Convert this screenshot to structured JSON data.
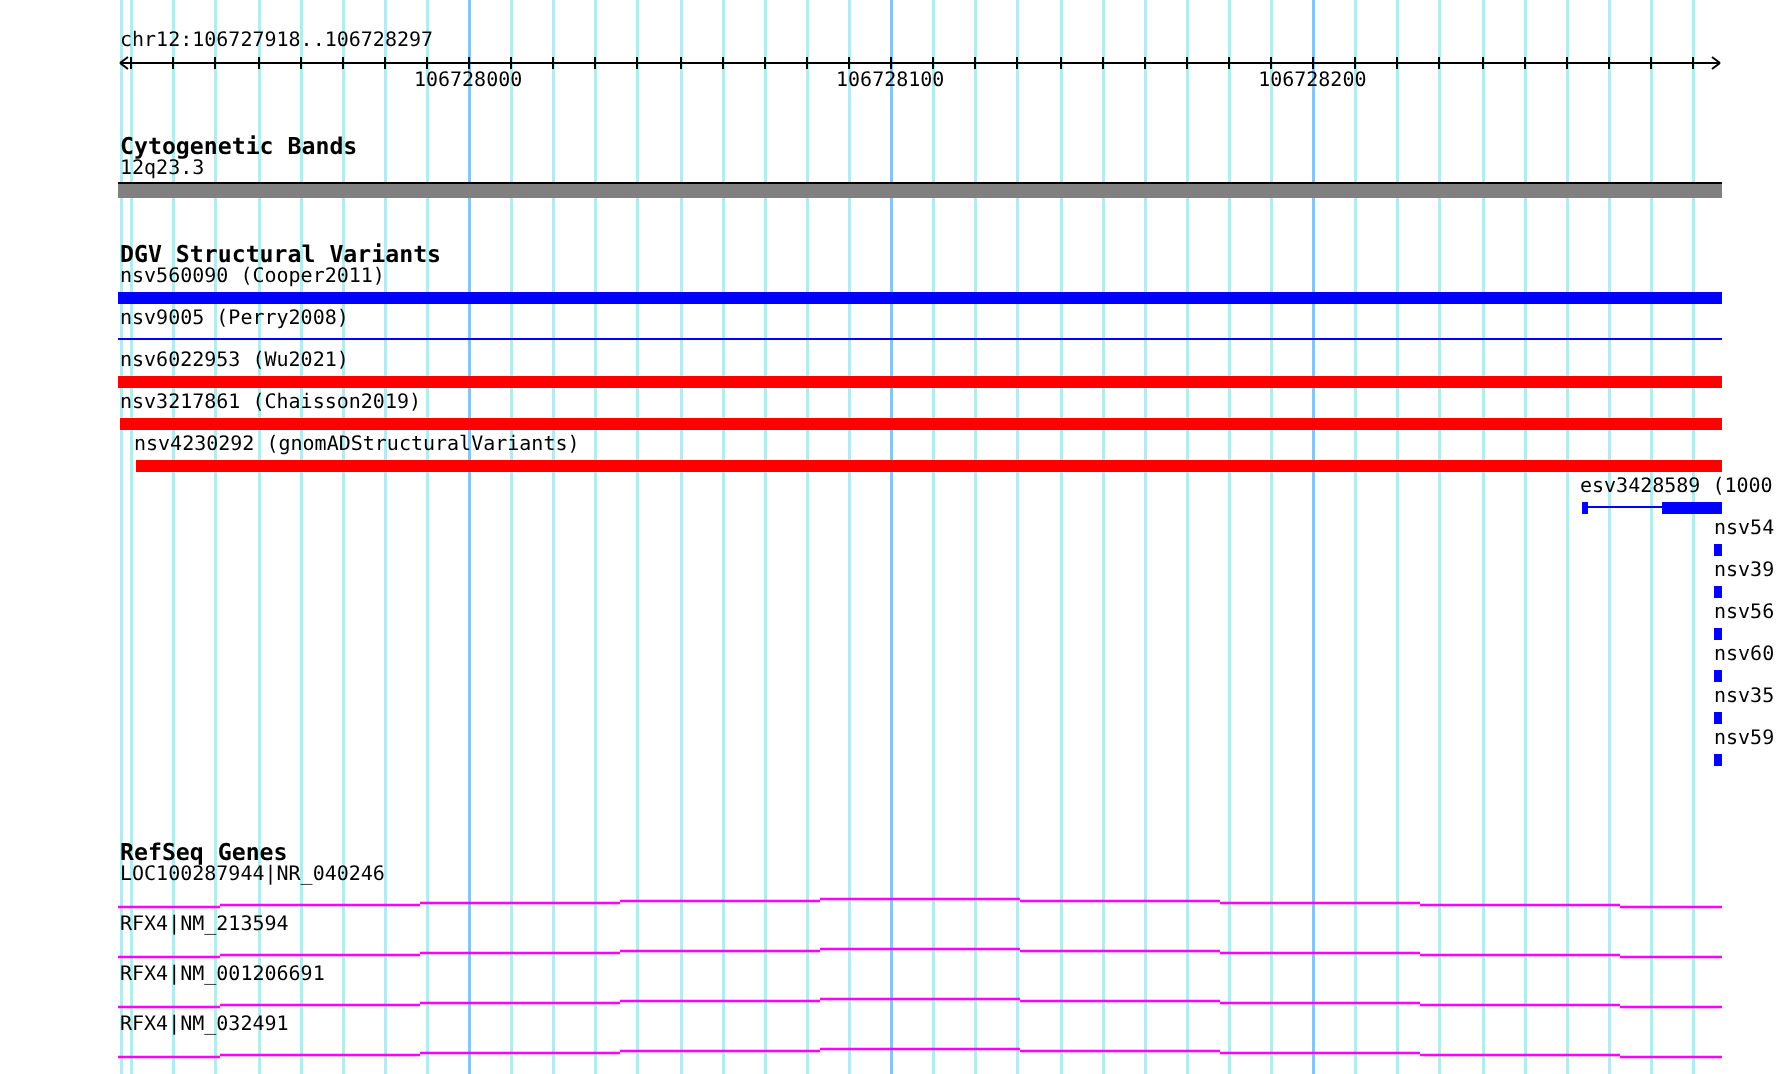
{
  "ruler": {
    "region": "chr12:106727918..106728297",
    "ticks": [
      "106728000",
      "106728100",
      "106728200"
    ]
  },
  "tracks": [
    {
      "title": "Cytogenetic Bands",
      "features": [
        {
          "kind": "band",
          "label": "12q23.3"
        }
      ]
    },
    {
      "title": "DGV Structural Variants",
      "features": [
        {
          "kind": "bar",
          "label": "nsv560090 (Cooper2011)",
          "color": "#0000ff"
        },
        {
          "kind": "line",
          "label": "nsv9005 (Perry2008)",
          "color": "#0000ff"
        },
        {
          "kind": "bar",
          "label": "nsv6022953 (Wu2021)",
          "color": "#ff0000"
        },
        {
          "kind": "bar",
          "label": "nsv3217861 (Chaisson2019)",
          "color": "#ff0000"
        },
        {
          "kind": "bar",
          "label": "nsv4230292 (gnomADStructuralVariants)",
          "color": "#ff0000"
        },
        {
          "kind": "split",
          "label": "esv3428589 (1000",
          "color": "#0000ff"
        },
        {
          "kind": "bar",
          "label": "nsv54",
          "color": "#0000ff"
        },
        {
          "kind": "bar",
          "label": "nsv39",
          "color": "#0000ff"
        },
        {
          "kind": "bar",
          "label": "nsv56",
          "color": "#0000ff"
        },
        {
          "kind": "bar",
          "label": "nsv60",
          "color": "#0000ff"
        },
        {
          "kind": "bar",
          "label": "nsv35",
          "color": "#0000ff"
        },
        {
          "kind": "bar",
          "label": "nsv59",
          "color": "#0000ff"
        }
      ]
    },
    {
      "title": "RefSeq Genes",
      "features": [
        {
          "kind": "gene",
          "label": "LOC100287944|NR_040246"
        },
        {
          "kind": "gene",
          "label": "RFX4|NM_213594"
        },
        {
          "kind": "gene",
          "label": "RFX4|NM_001206691"
        },
        {
          "kind": "gene",
          "label": "RFX4|NM_032491"
        }
      ]
    }
  ]
}
